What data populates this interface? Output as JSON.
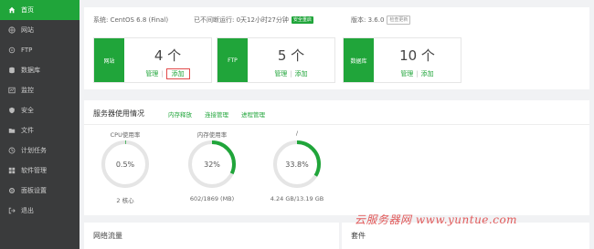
{
  "sidebar": {
    "items": [
      {
        "label": "首页",
        "icon": "home-icon",
        "active": true
      },
      {
        "label": "网站",
        "icon": "globe-icon"
      },
      {
        "label": "FTP",
        "icon": "ftp-icon"
      },
      {
        "label": "数据库",
        "icon": "database-icon"
      },
      {
        "label": "监控",
        "icon": "monitor-icon"
      },
      {
        "label": "安全",
        "icon": "shield-icon"
      },
      {
        "label": "文件",
        "icon": "folder-icon"
      },
      {
        "label": "计划任务",
        "icon": "clock-icon"
      },
      {
        "label": "软件管理",
        "icon": "apps-icon"
      },
      {
        "label": "面板设置",
        "icon": "settings-icon"
      },
      {
        "label": "退出",
        "icon": "logout-icon"
      }
    ]
  },
  "system_info": {
    "system": "系统: CentOS 6.8 (Final)",
    "uptime": "已不间断运行: 0天12小时27分钟",
    "secure_badge": "安全重启",
    "version": "版本: 3.6.0",
    "update_badge": "检查更新"
  },
  "stats": [
    {
      "name": "网站",
      "count": "4 个",
      "manage": "管理",
      "add": "添加"
    },
    {
      "name": "FTP",
      "count": "5 个",
      "manage": "管理",
      "add": "添加"
    },
    {
      "name": "数据库",
      "count": "10 个",
      "manage": "管理",
      "add": "添加"
    }
  ],
  "usage": {
    "title": "服务器使用情况",
    "tabs": [
      "内存释放",
      "连接管理",
      "进程管理"
    ],
    "gauges": [
      {
        "title": "CPU使用率",
        "value": "0.5%",
        "percent": 0.5,
        "sub": "2 核心"
      },
      {
        "title": "内存使用率",
        "value": "32%",
        "percent": 32,
        "sub": "602/1869 (MB)"
      },
      {
        "title": "/",
        "value": "33.8%",
        "percent": 33.8,
        "sub": "4.24 GB/13.19 GB"
      }
    ]
  },
  "bottom": {
    "network_title": "网络流量",
    "plugins_title": "套件"
  },
  "watermark": "云服务器网 www.yuntue.com",
  "colors": {
    "accent": "#20a53a",
    "sidebar": "#3a3b3c",
    "highlight": "#e24b4b"
  }
}
